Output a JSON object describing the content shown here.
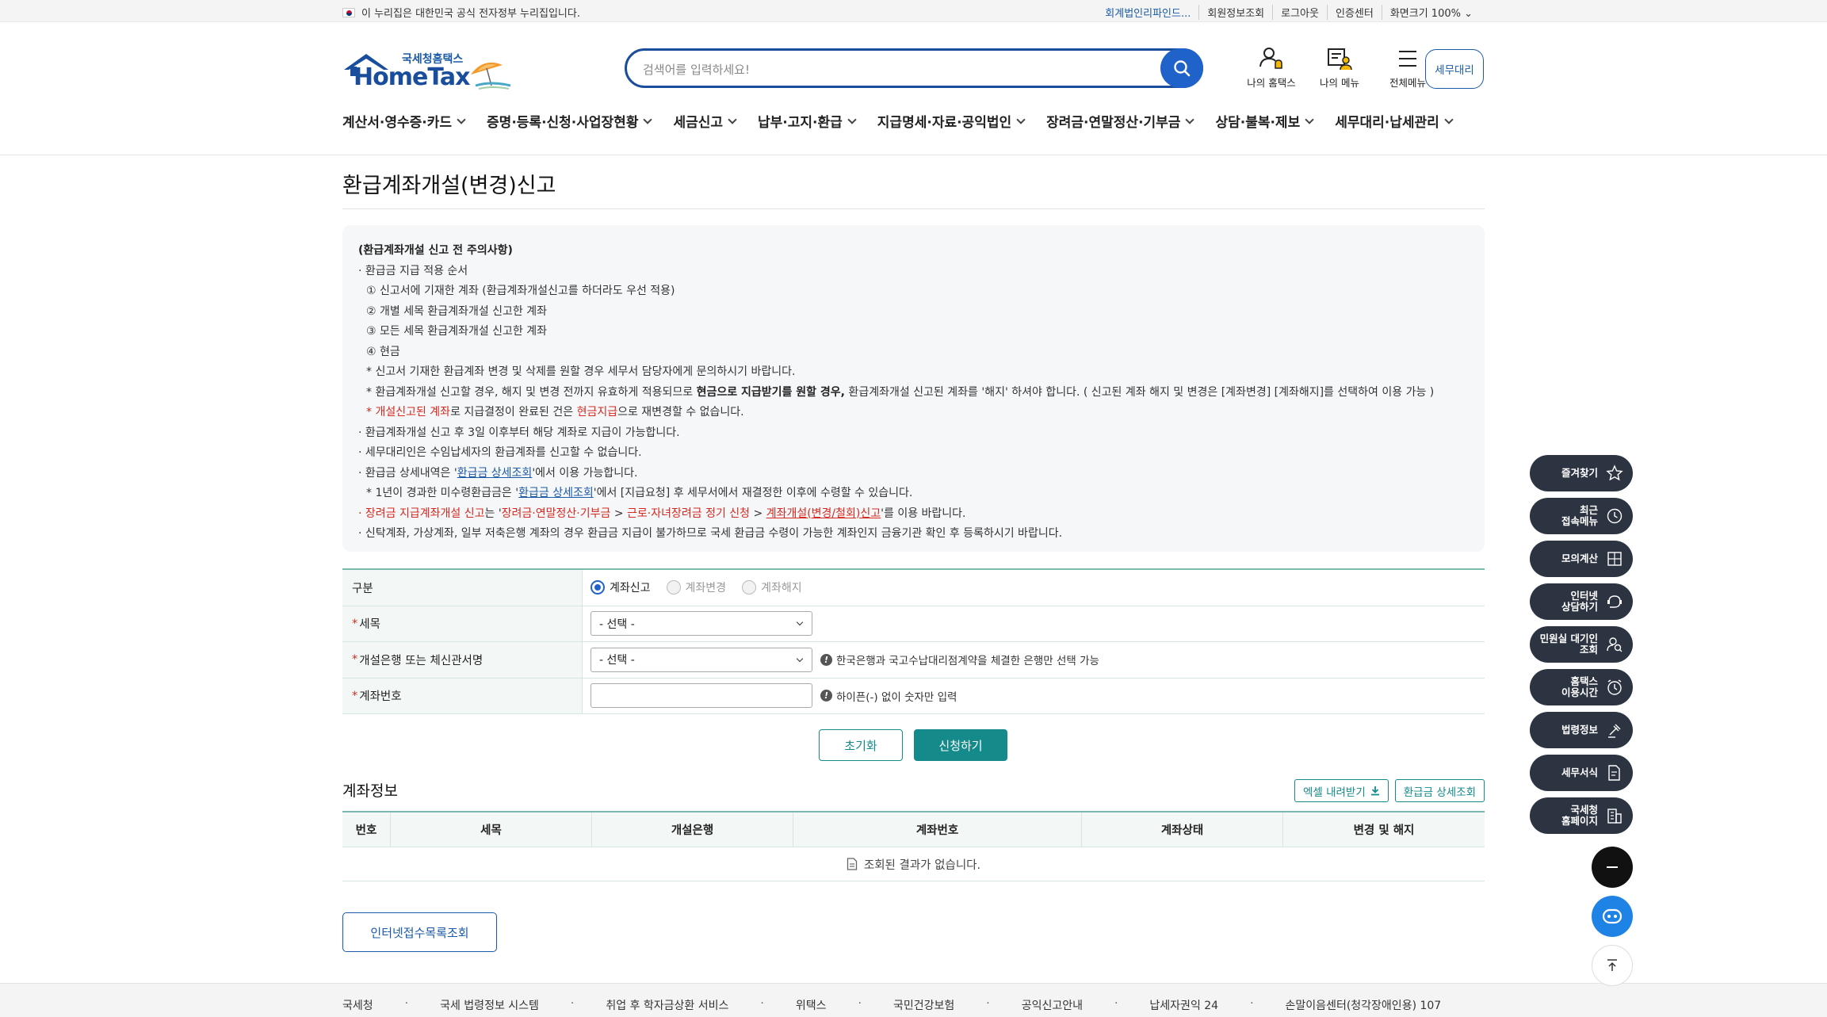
{
  "topbar": {
    "gov_notice": "이 누리집은 대한민국 공식 전자정부 누리집입니다.",
    "links": [
      "회계법인리파인드...",
      "회원정보조회",
      "로그아웃",
      "인증센터",
      "화면크기 100%"
    ]
  },
  "header": {
    "logo_small": "국세청홈택스",
    "logo_big": "HomeTax",
    "search_placeholder": "검색어를 입력하세요!",
    "icons": [
      {
        "label": "나의 홈택스",
        "icon": "user-bell-icon"
      },
      {
        "label": "나의 메뉴",
        "icon": "my-menu-icon"
      },
      {
        "label": "전체메뉴",
        "icon": "hamburger-icon"
      }
    ],
    "tax_agent_button": "세무대리"
  },
  "gnb": [
    "계산서·영수증·카드",
    "증명·등록·신청·사업장현황",
    "세금신고",
    "납부·고지·환급",
    "지급명세·자료·공익법인",
    "장려금·연말정산·기부금",
    "상담·불복·제보",
    "세무대리·납세관리"
  ],
  "page": {
    "title": "환급계좌개설(변경)신고"
  },
  "notice": {
    "heading": "(환급계좌개설 신고 전 주의사항)",
    "l1": "· 환급금 지급 적용 순서",
    "l2": "① 신고서에 기재한 계좌 (환급계좌개설신고를 하더라도 우선 적용)",
    "l3": "② 개별 세목 환급계좌개설 신고한 계좌",
    "l4": "③ 모든 세목 환급계좌개설 신고한 계좌",
    "l5": "④ 현금",
    "l6": "* 신고서 기재한 환급계좌 변경 및 삭제를 원할 경우 세무서 담당자에게 문의하시기 바랍니다.",
    "l7a": "* 환급계좌개설 신고할 경우, 해지 및 변경 전까지 유효하게 적용되므로 ",
    "l7b": "현금으로 지급받기를 원할 경우,",
    "l7c": " 환급계좌개설 신고된 계좌를 '해지' 하셔야 합니다. ( 신고된 계좌 해지 및 변경은 [계좌변경] [계좌해지]를 선택하여 이용 가능 )",
    "l8a": "* ",
    "l8b": "개설신고된 계좌",
    "l8c": "로 지급결정이 완료된 건은 ",
    "l8d": "현금지급",
    "l8e": "으로 재변경할 수 없습니다.",
    "l9": "· 환급계좌개설 신고 후 3일 이후부터 해당 계좌로 지급이 가능합니다.",
    "l10": "· 세무대리인은 수임납세자의 환급계좌를 신고할 수 없습니다.",
    "l11a": "· 환급금 상세내역은 '",
    "l11b": "환급금 상세조회",
    "l11c": "'에서 이용 가능합니다.",
    "l12a": "* 1년이 경과한 미수령환급금은 '",
    "l12b": "환급금 상세조회",
    "l12c": "'에서 [지급요청] 후 세무서에서 재결정한 이후에 수령할 수 있습니다.",
    "l13a": "· 장려금 지급계좌개설 신고",
    "l13b": "는 '",
    "l13c": "장려금·연말정산·기부금",
    "l13d": " > ",
    "l13e": "근로·자녀장려금 정기 신청",
    "l13f": " > ",
    "l13g": "계좌개설(변경/철회)신고",
    "l13h": "'를 이용 바랍니다.",
    "l14": "· 신탁계좌, 가상계좌, 일부 저축은행 계좌의 경우 환급금 지급이 불가하므로 국세 환급금 수령이 가능한 계좌인지 금융기관 확인 후 등록하시기 바랍니다."
  },
  "form": {
    "type_label": "구분",
    "radios": [
      "계좌신고",
      "계좌변경",
      "계좌해지"
    ],
    "tax_item_label": "세목",
    "tax_item_value": "- 선택 -",
    "bank_label": "개설은행 또는 체신관서명",
    "bank_value": "- 선택 -",
    "bank_hint": "한국은행과 국고수납대리점계약을 체결한 은행만 선택 가능",
    "account_label": "계좌번호",
    "account_hint": "하이픈(-) 없이 숫자만 입력",
    "reset_button": "초기화",
    "apply_button": "신청하기"
  },
  "account_info": {
    "title": "계좌정보",
    "excel_button": "엑셀 내려받기",
    "refund_button": "환급금 상세조회",
    "columns": [
      "번호",
      "세목",
      "개설은행",
      "계좌번호",
      "계좌상태",
      "변경 및 해지"
    ],
    "empty": "조회된 결과가 없습니다.",
    "net_button": "인터넷접수목록조회"
  },
  "footer": {
    "links": [
      "국세청",
      "국세 법령정보 시스템",
      "취업 후 학자금상환 서비스",
      "위택스",
      "국민건강보험",
      "공익신고안내",
      "납세자권익 24",
      "손말이음센터(청각장애인용) 107"
    ]
  },
  "quick_menu": [
    {
      "label": [
        "즐겨찾기"
      ],
      "icon": "star-icon"
    },
    {
      "label": [
        "최근",
        "접속메뉴"
      ],
      "icon": "clock-icon"
    },
    {
      "label": [
        "모의계산"
      ],
      "icon": "calculator-icon"
    },
    {
      "label": [
        "인터넷",
        "상담하기"
      ],
      "icon": "chat-icon"
    },
    {
      "label": [
        "민원실 대기인",
        "조회"
      ],
      "icon": "person-search-icon"
    },
    {
      "label": [
        "홈택스",
        "이용시간"
      ],
      "icon": "alarm-icon"
    },
    {
      "label": [
        "법령정보"
      ],
      "icon": "scale-icon"
    },
    {
      "label": [
        "세무서식"
      ],
      "icon": "form-icon"
    },
    {
      "label": [
        "국세청",
        "홈페이지"
      ],
      "icon": "building-icon"
    }
  ]
}
